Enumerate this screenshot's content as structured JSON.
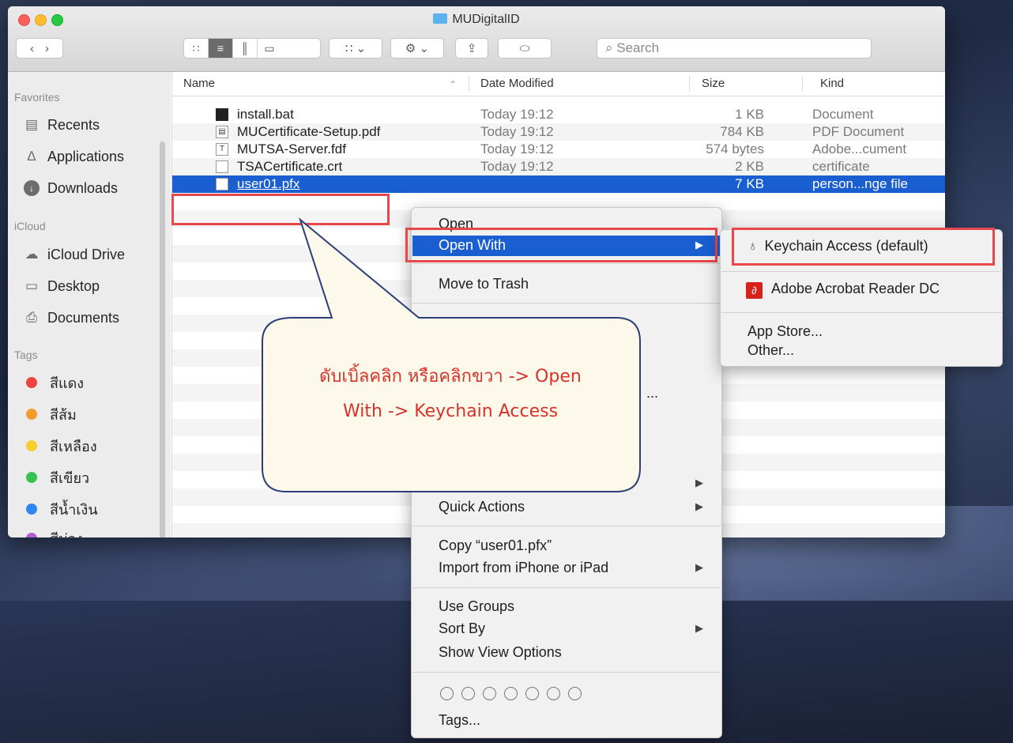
{
  "window": {
    "title": "MUDigitalID"
  },
  "toolbar": {
    "search_placeholder": "Search"
  },
  "sidebar": {
    "favorites_header": "Favorites",
    "favorites": [
      "Recents",
      "Applications",
      "Downloads"
    ],
    "icloud_header": "iCloud",
    "icloud": [
      "iCloud Drive",
      "Desktop",
      "Documents"
    ],
    "tags_header": "Tags",
    "tags": [
      {
        "label": "สีแดง",
        "color": "#f0443e"
      },
      {
        "label": "สีส้ม",
        "color": "#f39b2b"
      },
      {
        "label": "สีเหลือง",
        "color": "#f6cf2e"
      },
      {
        "label": "สีเขียว",
        "color": "#36c352"
      },
      {
        "label": "สีน้ำเงิน",
        "color": "#2f86f2"
      },
      {
        "label": "สีม่วง",
        "color": "#b05fd2"
      }
    ]
  },
  "list": {
    "columns": {
      "name": "Name",
      "date": "Date Modified",
      "size": "Size",
      "kind": "Kind"
    },
    "files": [
      {
        "name": "install.bat",
        "date": "Today 19:12",
        "size": "1 KB",
        "kind": "Document"
      },
      {
        "name": "MUCertificate-Setup.pdf",
        "date": "Today 19:12",
        "size": "784 KB",
        "kind": "PDF Document"
      },
      {
        "name": "MUTSA-Server.fdf",
        "date": "Today 19:12",
        "size": "574 bytes",
        "kind": "Adobe...cument"
      },
      {
        "name": "TSACertificate.crt",
        "date": "Today 19:12",
        "size": "2 KB",
        "kind": "certificate"
      },
      {
        "name": "user01.pfx",
        "date": "",
        "size": "7 KB",
        "kind": "person...nge file"
      }
    ]
  },
  "context_menu": {
    "open": "Open",
    "open_with": "Open With",
    "move_to_trash": "Move to Trash",
    "quick_actions": "Quick Actions",
    "copy": "Copy “user01.pfx”",
    "import": "Import from iPhone or iPad",
    "use_groups": "Use Groups",
    "sort_by": "Sort By",
    "show_view_options": "Show View Options",
    "tags": "Tags...",
    "ellipsis": "..."
  },
  "submenu": {
    "keychain": "Keychain Access (default)",
    "acrobat": "Adobe Acrobat Reader DC",
    "app_store": "App Store...",
    "other": "Other..."
  },
  "annotation": {
    "line1": "ดับเบิ้ลคลิก หรือคลิกขวา -> Open",
    "line2": "With -> Keychain Access",
    "highlight_color": "#e8474b",
    "callout_fill": "#fdf9ea",
    "callout_stroke": "#2c3f78"
  }
}
